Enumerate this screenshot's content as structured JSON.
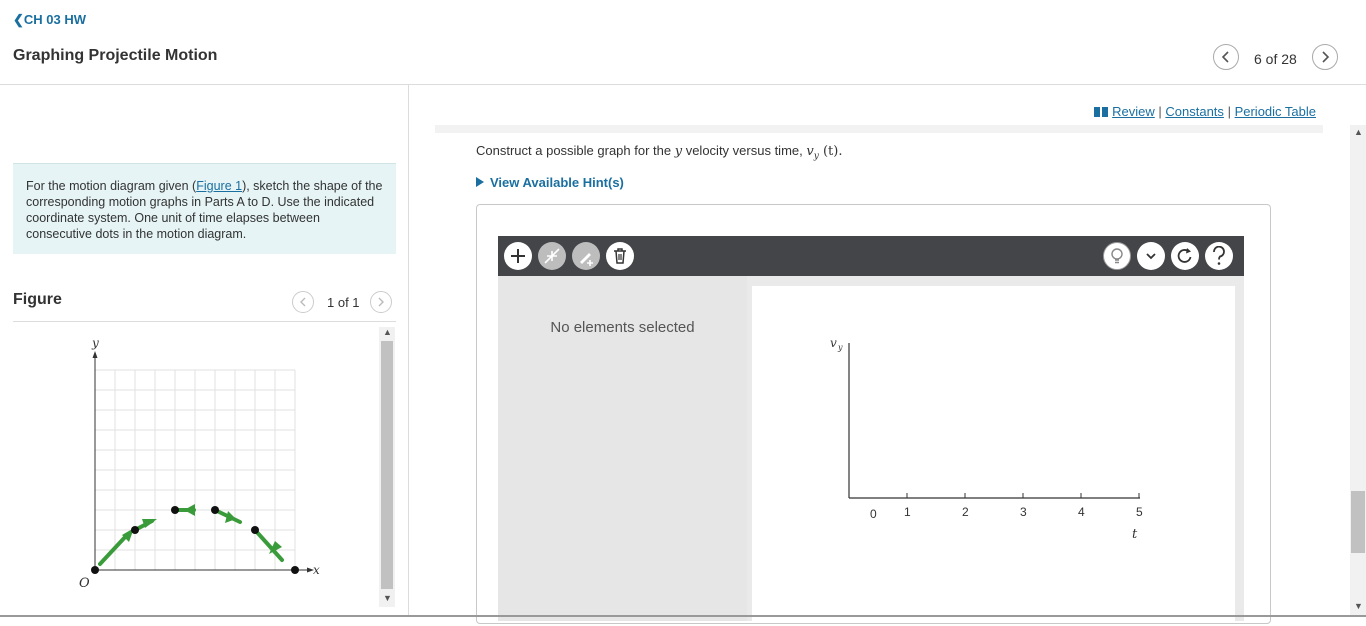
{
  "header": {
    "back_label": "CH 03 HW",
    "title": "Graphing Projectile Motion",
    "pager": "6 of 28"
  },
  "intro": {
    "text_before": "For the motion diagram given (",
    "figure_link": "Figure 1",
    "text_after": "), sketch the shape of the corresponding motion graphs in Parts A to D. Use the indicated coordinate system. One unit of time elapses between consecutive dots in the motion diagram."
  },
  "figure": {
    "title": "Figure",
    "pager": "1 of 1",
    "axis_y": "y",
    "axis_x": "x",
    "origin": "O"
  },
  "links": {
    "review": "Review",
    "constants": "Constants",
    "periodic_table": "Periodic Table",
    "separator": "|"
  },
  "question": {
    "prompt_before": "Construct a possible graph for the ",
    "prompt_var": "y",
    "prompt_middle": " velocity versus time, ",
    "prompt_math": "v",
    "prompt_sub": "y",
    "prompt_after": " (t).",
    "hint": "View Available Hint(s)"
  },
  "tools": {
    "left": [
      "add-icon",
      "line-icon",
      "edit-icon",
      "trash-icon"
    ],
    "right": [
      "hint-bulb-icon",
      "chevron-down-icon",
      "reset-icon",
      "help-icon"
    ]
  },
  "panel": {
    "message": "No elements selected"
  },
  "graph": {
    "y_label": "v",
    "y_label_sub": "y",
    "x_label": "t",
    "ticks": [
      "0",
      "1",
      "2",
      "3",
      "4",
      "5"
    ]
  },
  "colors": {
    "accent": "#1a6fa0",
    "toolbar": "#444549",
    "motion": "#3a9b3a"
  }
}
